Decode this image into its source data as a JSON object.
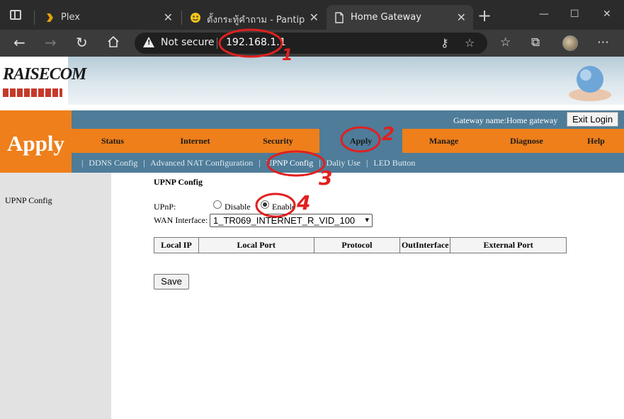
{
  "browser": {
    "tabs": [
      {
        "title": "Plex",
        "favicon": "plex-chevron-icon",
        "active": false
      },
      {
        "title": "ตั้งกระทู้คำถาม - Pantip",
        "favicon": "pantip-emoji-icon",
        "active": false
      },
      {
        "title": "Home Gateway",
        "favicon": "page-icon",
        "active": true
      }
    ],
    "security_label": "Not secure",
    "url": "192.168.1.1"
  },
  "banner": {
    "logo_text": "RAISECOM"
  },
  "header": {
    "gateway_name": "Gateway name:Home gateway",
    "exit_label": "Exit Login",
    "section_title": "Apply"
  },
  "menu": {
    "items": [
      "Status",
      "Internet",
      "Security",
      "Apply",
      "Manage",
      "Diagnose",
      "Help"
    ],
    "active": "Apply"
  },
  "submenu": {
    "separator": "|",
    "items": [
      "DDNS Config",
      "Advanced NAT Configuration",
      "UPNP Config",
      "Daliy Use",
      "LED Button"
    ],
    "current": "UPNP Config"
  },
  "sidebar": {
    "items": [
      "UPNP Config"
    ]
  },
  "content": {
    "title": "UPNP Config",
    "upnp_label": "UPnP:",
    "disable_label": "Disable",
    "enable_label": "Enable",
    "upnp_value": "Enable",
    "wan_label": "WAN Interface:",
    "wan_value": "1_TR069_INTERNET_R_VID_100",
    "table_headers": [
      "Local IP",
      "Local Port",
      "Protocol",
      "OutInterface",
      "External Port"
    ],
    "save_label": "Save"
  },
  "annotations": {
    "numbers": [
      "1",
      "2",
      "3",
      "4"
    ],
    "color": "#e0201f"
  },
  "colors": {
    "orange": "#ef7f1a",
    "steel_blue": "#4e7c99",
    "sidebar_gray": "#e2e2e2"
  }
}
